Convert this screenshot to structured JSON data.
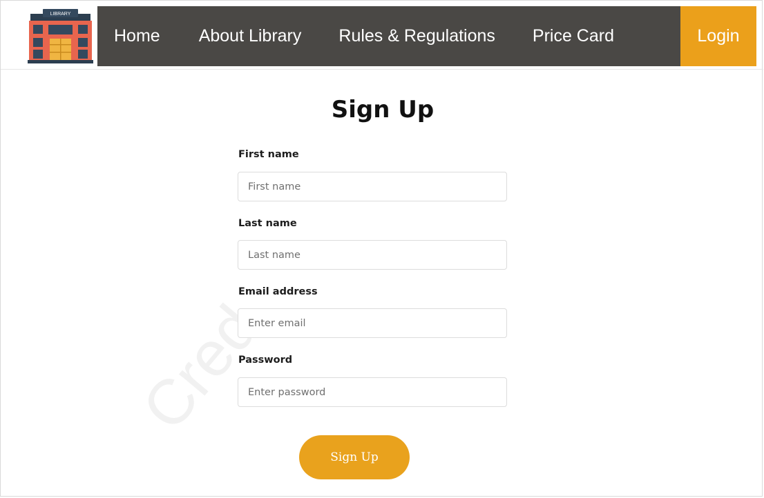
{
  "logo": {
    "icon": "library-building-icon",
    "sign_text": "LIBRARY",
    "colors": {
      "roof": "#2c3e50",
      "wall": "#e8654e",
      "door": "#f0b542",
      "sign": "#34495e",
      "circle": "#cfd8dc"
    }
  },
  "nav": {
    "items": [
      {
        "label": "Home"
      },
      {
        "label": "About Library"
      },
      {
        "label": "Rules & Regulations"
      },
      {
        "label": "Price Card"
      }
    ],
    "login_label": "Login",
    "colors": {
      "bar": "#4a4845",
      "login": "#eba01b"
    }
  },
  "form": {
    "title": "Sign Up",
    "fields": [
      {
        "label": "First name",
        "placeholder": "First name",
        "value": ""
      },
      {
        "label": "Last name",
        "placeholder": "Last name",
        "value": ""
      },
      {
        "label": "Email address",
        "placeholder": "Enter email",
        "value": ""
      },
      {
        "label": "Password",
        "placeholder": "Enter password",
        "value": ""
      }
    ],
    "submit_label": "Sign Up",
    "accent": "#e9a21d"
  },
  "watermark": {
    "text": "Cred"
  }
}
